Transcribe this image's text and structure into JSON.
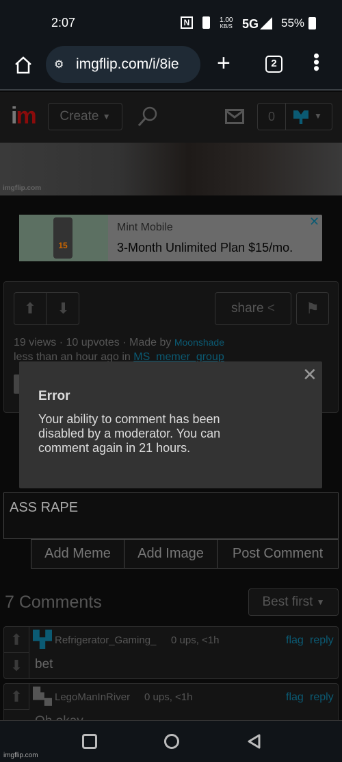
{
  "status_bar": {
    "time": "2:07",
    "speed": "1.00",
    "speed_unit": "KB/S",
    "network": "5G",
    "battery": "55%"
  },
  "browser": {
    "url": "imgflip.com/i/8ie",
    "tab_count": "2"
  },
  "site_header": {
    "logo": "im",
    "create_label": "Create",
    "notification_count": "0"
  },
  "meme": {
    "watermark": "imgflip.com"
  },
  "ad": {
    "brand": "Mint Mobile",
    "headline": "3-Month Unlimited Plan $15/mo.",
    "image_text": "15"
  },
  "post": {
    "share_label": "share",
    "views": "19 views",
    "upvotes": "10 upvotes",
    "made_by": "Made by",
    "author": "Moonshade",
    "time": "less than an hour ago in",
    "stream": "MS_memer_group",
    "separator": "·"
  },
  "error_modal": {
    "title": "Error",
    "message": "Your ability to comment has been disabled by a moderator. You can comment again in 21 hours."
  },
  "comment_form": {
    "value": "ASS RAPE",
    "add_meme": "Add Meme",
    "add_image": "Add Image",
    "post_comment": "Post Comment"
  },
  "comments_header": {
    "count_label": "7 Comments",
    "sort": "Best first"
  },
  "comments": [
    {
      "user": "Refrigerator_Gaming_",
      "meta": "0 ups, <1h",
      "text": "bet",
      "flag": "flag",
      "reply": "reply",
      "avatar_color": "#0b5a73"
    },
    {
      "user": "LegoManInRiver",
      "meta": "0 ups, <1h",
      "text": "Oh okay",
      "flag": "flag",
      "reply": "reply",
      "avatar_color": "#666666"
    }
  ],
  "footer_watermark": "imgflip.com"
}
